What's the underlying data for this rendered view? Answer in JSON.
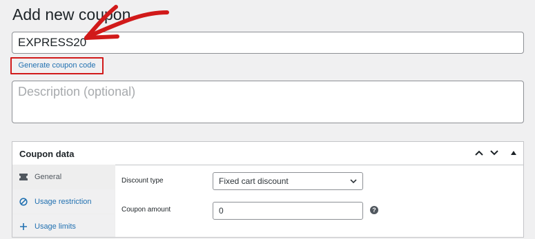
{
  "page_title": "Add new coupon",
  "coupon_code": {
    "value": "EXPRESS20"
  },
  "generate_link_label": "Generate coupon code",
  "description": {
    "placeholder": "Description (optional)",
    "value": ""
  },
  "coupon_data": {
    "title": "Coupon data",
    "tabs": [
      {
        "label": "General",
        "icon": "ticket-icon",
        "active": true
      },
      {
        "label": "Usage restriction",
        "icon": "prohibited-icon",
        "active": false
      },
      {
        "label": "Usage limits",
        "icon": "plus-icon",
        "active": false
      }
    ],
    "fields": {
      "discount_type": {
        "label": "Discount type",
        "value": "Fixed cart discount"
      },
      "coupon_amount": {
        "label": "Coupon amount",
        "value": "0"
      }
    }
  },
  "colors": {
    "accent": "#2271b1",
    "highlight": "#d11a1a"
  }
}
